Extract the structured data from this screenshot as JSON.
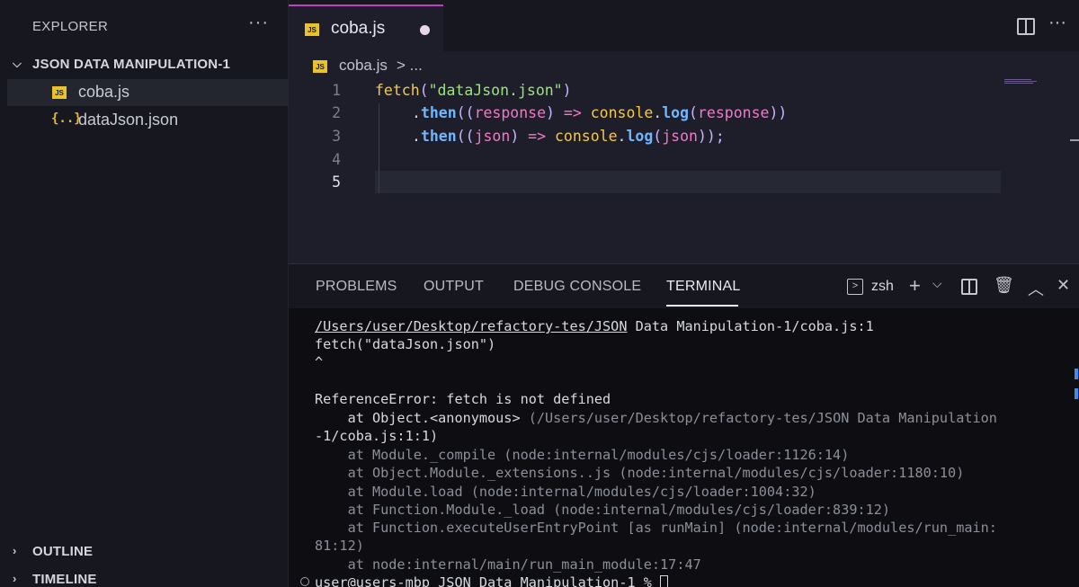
{
  "explorer": {
    "title": "EXPLORER",
    "more_icon": "ellipsis-icon",
    "folder": "JSON DATA MANIPULATION-1",
    "files": [
      {
        "name": "coba.js",
        "icon": "javascript-file-icon",
        "active": true
      },
      {
        "name": "dataJson.json",
        "icon": "json-file-icon",
        "active": false
      }
    ],
    "outline_label": "OUTLINE",
    "timeline_label": "TIMELINE"
  },
  "editor": {
    "tab": {
      "label": "coba.js",
      "badge": "JS",
      "modified": true,
      "accent": "#c33ec2"
    },
    "breadcrumb": {
      "file": "coba.js",
      "rest": "> ..."
    },
    "line_numbers": [
      "1",
      "2",
      "3",
      "4",
      "5"
    ],
    "current_line": "5",
    "code": {
      "l1": {
        "fn": "fetch",
        "open": "(",
        "str": "\"dataJson.json\"",
        "close": ")"
      },
      "l2": {
        "dot": ".",
        "kw": "then",
        "p1": "((",
        "param": "response",
        "p2": ")",
        "arrow": " => ",
        "obj": "console",
        "dot2": ".",
        "method": "log",
        "p3": "(",
        "arg": "response",
        "p4": "))"
      },
      "l3": {
        "dot": ".",
        "kw": "then",
        "p1": "((",
        "param": "json",
        "p2": ")",
        "arrow": " => ",
        "obj": "console",
        "dot2": ".",
        "method": "log",
        "p3": "(",
        "arg": "json",
        "p4": "));"
      }
    }
  },
  "panel": {
    "tabs": [
      "PROBLEMS",
      "OUTPUT",
      "DEBUG CONSOLE",
      "TERMINAL"
    ],
    "active_tab": "TERMINAL",
    "shell": "zsh",
    "terminal": {
      "path_link": "/Users/user/Desktop/refactory-tes/JSON",
      "path_rest": " Data Manipulation-1/coba.js:1",
      "lines": [
        "fetch(\"dataJson.json\")",
        "^",
        "",
        "ReferenceError: fetch is not defined",
        "    at Object.<anonymous> (/Users/user/Desktop/refactory-tes/JSON Data Manipulation",
        "-1/coba.js:1:1)",
        "    at Module._compile (node:internal/modules/cjs/loader:1126:14)",
        "    at Object.Module._extensions..js (node:internal/modules/cjs/loader:1180:10)",
        "    at Module.load (node:internal/modules/cjs/loader:1004:32)",
        "    at Function.Module._load (node:internal/modules/cjs/loader:839:12)",
        "    at Function.executeUserEntryPoint [as runMain] (node:internal/modules/run_main:",
        "81:12)",
        "    at node:internal/main/run_main_module:17:47"
      ],
      "prompt": "user@users-mbp JSON Data Manipulation-1 % "
    }
  }
}
